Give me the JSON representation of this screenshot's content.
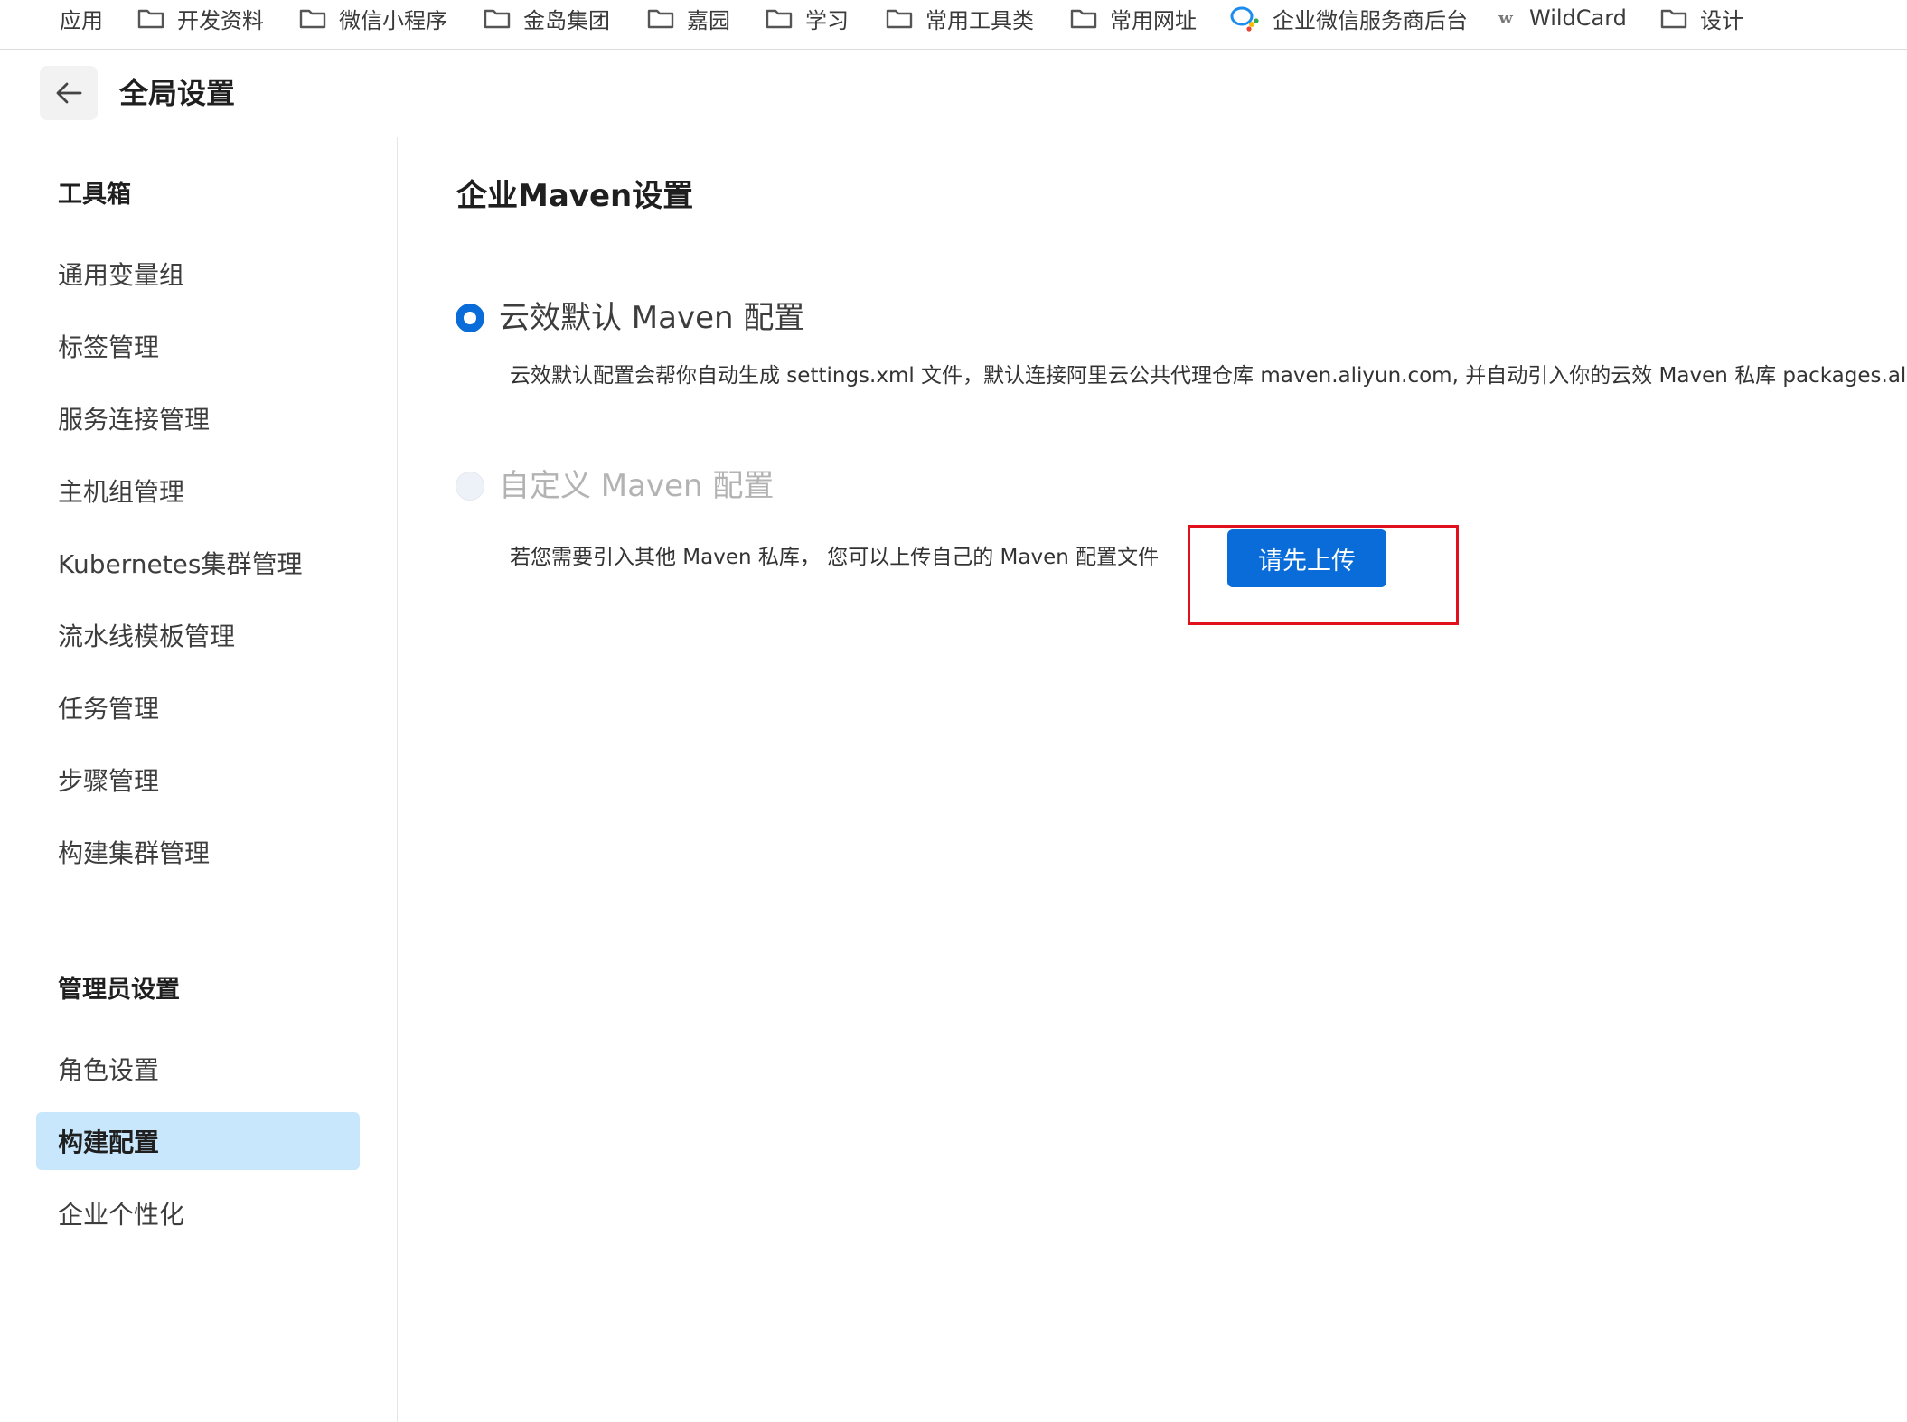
{
  "bookmarks": [
    {
      "label": "应用",
      "icon": "apps-grid-icon"
    },
    {
      "label": "开发资料",
      "icon": "folder-icon"
    },
    {
      "label": "微信小程序",
      "icon": "folder-icon"
    },
    {
      "label": "金岛集团",
      "icon": "folder-icon"
    },
    {
      "label": "嘉园",
      "icon": "folder-icon"
    },
    {
      "label": "学习",
      "icon": "folder-icon"
    },
    {
      "label": "常用工具类",
      "icon": "folder-icon"
    },
    {
      "label": "常用网址",
      "icon": "folder-icon"
    },
    {
      "label": "企业微信服务商后台",
      "icon": "wecom-logo-icon"
    },
    {
      "label": "WildCard",
      "icon": "w-logo-icon",
      "logo_text": "w"
    },
    {
      "label": "设计",
      "icon": "folder-icon"
    }
  ],
  "header": {
    "title": "全局设置",
    "back_icon": "arrow-left-icon"
  },
  "sidebar": {
    "groups": [
      {
        "title": "工具箱",
        "items": [
          {
            "label": "通用变量组"
          },
          {
            "label": "标签管理"
          },
          {
            "label": "服务连接管理"
          },
          {
            "label": "主机组管理"
          },
          {
            "label": "Kubernetes集群管理"
          },
          {
            "label": "流水线模板管理"
          },
          {
            "label": "任务管理"
          },
          {
            "label": "步骤管理"
          },
          {
            "label": "构建集群管理"
          }
        ]
      },
      {
        "title": "管理员设置",
        "items": [
          {
            "label": "角色设置"
          },
          {
            "label": "构建配置",
            "active": true
          },
          {
            "label": "企业个性化"
          }
        ]
      }
    ]
  },
  "main": {
    "section_title": "企业Maven设置",
    "options": [
      {
        "label": "云效默认 Maven 配置",
        "checked": true,
        "description": "云效默认配置会帮你自动生成 settings.xml 文件，默认连接阿里云公共代理仓库 maven.aliyun.com, 并自动引入你的云效 Maven 私库 packages.aliyun.com"
      },
      {
        "label": "自定义 Maven 配置",
        "checked": false,
        "disabled": true,
        "description": "若您需要引入其他 Maven 私库，  您可以上传自己的 Maven 配置文件"
      }
    ],
    "upload_button": "请先上传"
  },
  "colors": {
    "primary": "#0a6cd9",
    "active_bg": "#c9e7fc",
    "highlight": "#e0111d"
  }
}
